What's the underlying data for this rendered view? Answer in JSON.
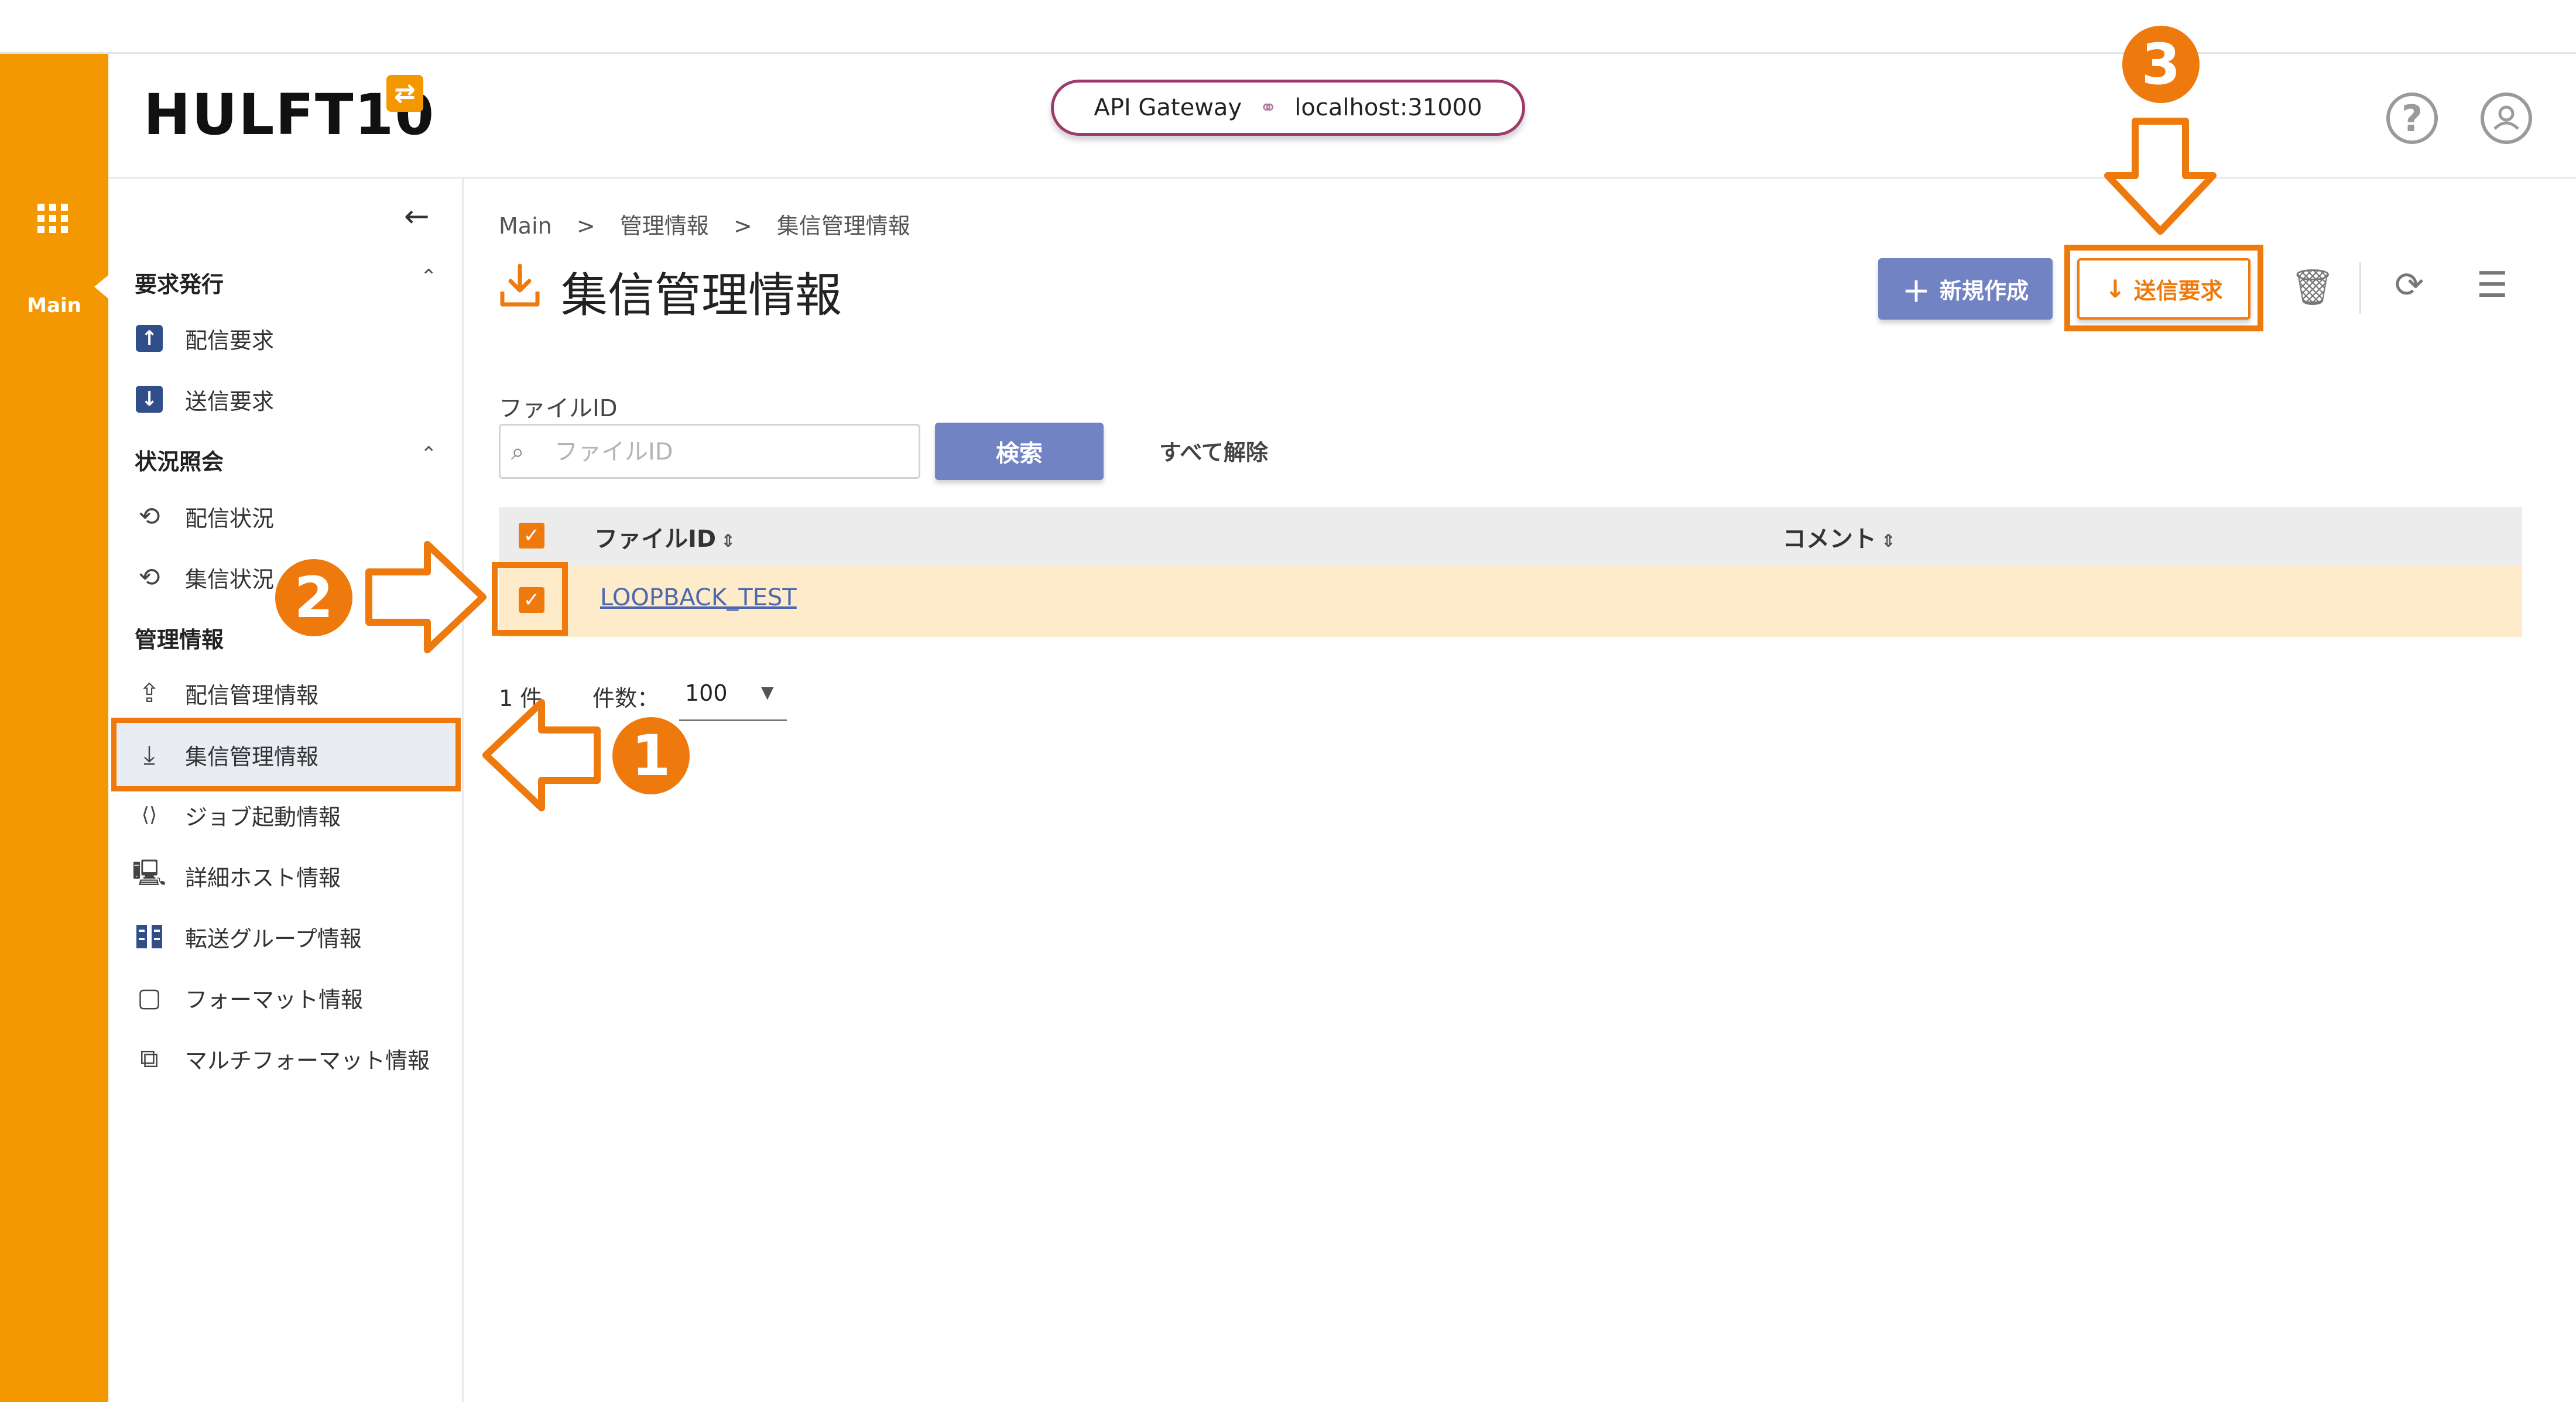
{
  "rail": {
    "label": "Main",
    "grid_icon": "apps-grid-icon"
  },
  "header": {
    "logo": "HULFT10",
    "logo_badge": "⇄",
    "gateway_label": "API Gateway",
    "gateway_host": "localhost:31000",
    "help_icon": "help-circle-icon",
    "user_icon": "user-circle-icon"
  },
  "sidebar": {
    "back_icon": "arrow-left-icon",
    "sections": {
      "request": "要求発行",
      "status": "状況照会",
      "management": "管理情報"
    },
    "items": {
      "send_request": "配信要求",
      "receive_request": "送信要求",
      "send_status": "配信状況",
      "receive_status": "集信状況",
      "send_mgmt": "配信管理情報",
      "receive_mgmt": "集信管理情報",
      "job_start": "ジョブ起動情報",
      "host_detail": "詳細ホスト情報",
      "transfer_group": "転送グループ情報",
      "format": "フォーマット情報",
      "multi_format": "マルチフォーマット情報"
    }
  },
  "breadcrumb": [
    "Main",
    ">",
    "管理情報",
    ">",
    "集信管理情報"
  ],
  "page": {
    "title": "集信管理情報"
  },
  "toolbar": {
    "new_label": "新規作成",
    "send_request_label": "送信要求",
    "delete_icon": "trash-icon",
    "refresh_icon": "refresh-icon",
    "settings_icon": "tune-icon"
  },
  "filter": {
    "label": "ファイルID",
    "placeholder": "ファイルID",
    "value": "",
    "search_label": "検索",
    "clear_label": "すべて解除"
  },
  "table": {
    "columns": [
      "ファイルID",
      "コメント"
    ],
    "rows": [
      {
        "file_id": "LOOPBACK_TEST",
        "comment": "",
        "checked": true
      }
    ]
  },
  "pagination": {
    "count": "1 件",
    "per_page_label": "件数：",
    "per_page": "100"
  },
  "callouts": [
    "1",
    "2",
    "3"
  ],
  "colors": {
    "accent": "#ee7a0d",
    "rail": "#f39800",
    "primary_button": "#7283c4",
    "selected_row": "#fdebc9"
  }
}
